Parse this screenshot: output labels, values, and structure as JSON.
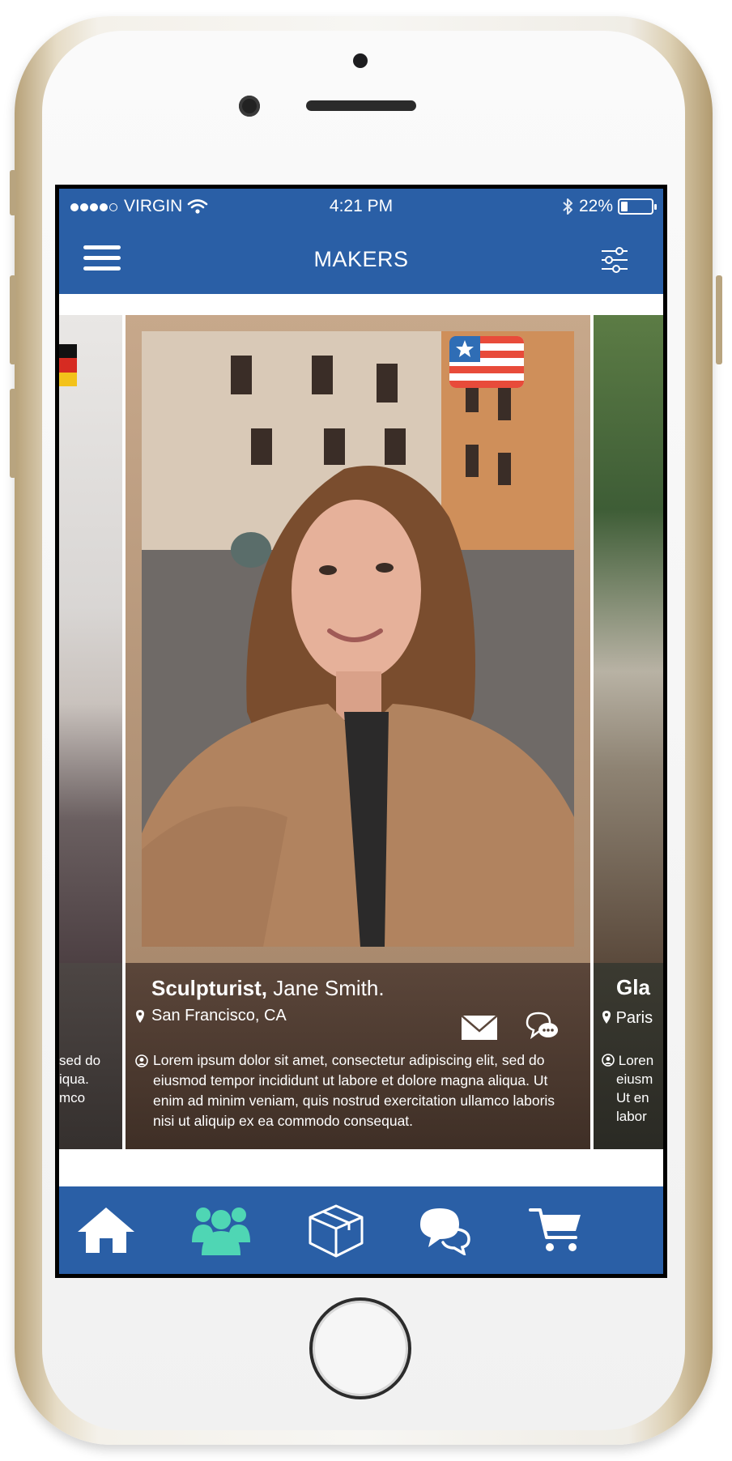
{
  "status_bar": {
    "carrier": "VIRGIN",
    "time": "4:21 PM",
    "battery_percent": "22%",
    "battery_level": 0.22,
    "signal_bars_filled": 4,
    "signal_bars_total": 5
  },
  "header": {
    "title": "MAKERS",
    "menu_icon": "hamburger-menu-icon",
    "filter_icon": "sliders-filter-icon"
  },
  "cards": {
    "main": {
      "role": "Sculpturist,",
      "name": "Jane Smith.",
      "location": "San Francisco, CA",
      "flag": "us-flag-icon",
      "description": "Lorem ipsum dolor sit amet, consectetur adipiscing elit, sed do eiusmod tempor incididunt ut labore et dolore magna aliqua. Ut enim ad minim veniam, quis nostrud exercitation ullamco laboris nisi ut aliquip ex ea commodo consequat.",
      "actions": [
        "mail-icon",
        "chat-icon"
      ]
    },
    "left": {
      "flag": "germany-flag-icon",
      "desc_line1": "sed do",
      "desc_line2": "iqua.",
      "desc_line3": "mco"
    },
    "right": {
      "role": "Gla",
      "location": "Paris",
      "desc_line1": "Loren",
      "desc_line2": "eiusm",
      "desc_line3": "Ut en",
      "desc_line4": "labor"
    }
  },
  "tab_bar": {
    "tabs": [
      {
        "icon": "home-icon",
        "active": false
      },
      {
        "icon": "people-icon",
        "active": true
      },
      {
        "icon": "box-icon",
        "active": false
      },
      {
        "icon": "chat-bubbles-icon",
        "active": false
      },
      {
        "icon": "cart-icon",
        "active": false
      }
    ]
  },
  "colors": {
    "brand_blue": "#2a5fa6",
    "active_tab": "#4fd6b4"
  }
}
